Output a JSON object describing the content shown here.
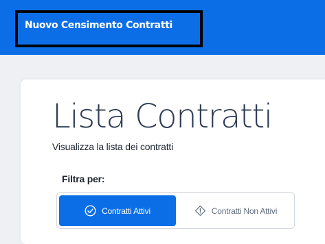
{
  "header": {
    "title": "Nuovo Censimento Contratti"
  },
  "main": {
    "title": "Lista Contratti",
    "subtitle": "Visualizza la lista dei contratti",
    "filter": {
      "label": "Filtra per:",
      "options": [
        {
          "label": "Contratti Attivi",
          "icon": "check-circle-icon",
          "selected": true
        },
        {
          "label": "Contratti Non Attivi",
          "icon": "warning-diamond-icon",
          "selected": false
        }
      ]
    }
  },
  "colors": {
    "primary": "#0b6ee6",
    "page_background": "#eef0f4",
    "title_text": "#2c3c53",
    "inactive_text": "#5f6b7b"
  }
}
